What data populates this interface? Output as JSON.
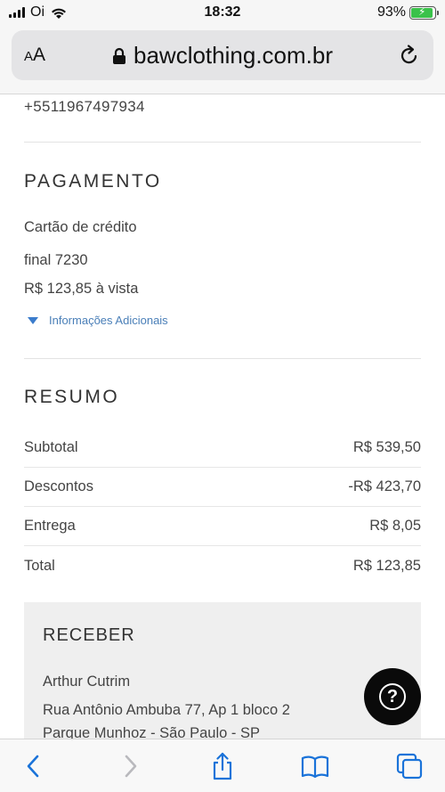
{
  "status_bar": {
    "carrier": "Oi",
    "time": "18:32",
    "battery": "93%",
    "battery_level": 0.93
  },
  "browser": {
    "text_size_label_small": "A",
    "text_size_label_large": "A",
    "domain": "bawclothing.com.br"
  },
  "contact": {
    "phone": "+5511967497934"
  },
  "payment": {
    "title": "PAGAMENTO",
    "method": "Cartão de crédito",
    "card_ending": "final 7230",
    "amount_terms": "R$ 123,85 à vista",
    "more_info": "Informações Adicionais"
  },
  "summary": {
    "title": "RESUMO",
    "rows": [
      {
        "label": "Subtotal",
        "value": "R$ 539,50"
      },
      {
        "label": "Descontos",
        "value": "-R$ 423,70"
      },
      {
        "label": "Entrega",
        "value": "R$ 8,05"
      },
      {
        "label": "Total",
        "value": "R$ 123,85"
      }
    ]
  },
  "receive": {
    "title": "RECEBER",
    "name": "Arthur Cutrim",
    "address_line1": "Rua Antônio Ambuba 77, Ap 1 bloco 2",
    "address_line2": "Parque Munhoz - São Paulo - SP"
  },
  "help": {
    "symbol": "?"
  },
  "colors": {
    "link": "#4a7fb8",
    "toolbar_icon": "#1a73d9",
    "battery": "#3ac24a"
  }
}
